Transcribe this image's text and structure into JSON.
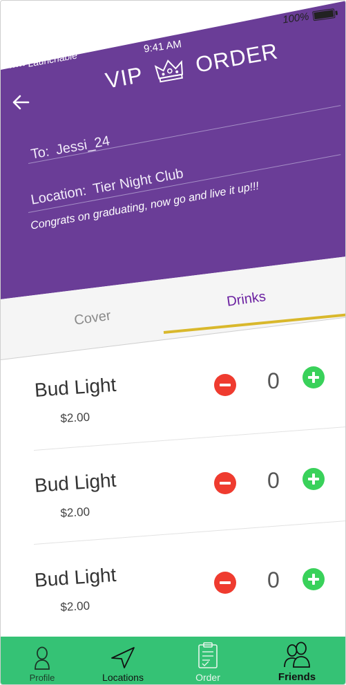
{
  "status_bar": {
    "carrier": "••••• Launchable",
    "time": "9:41 AM",
    "battery": "100%"
  },
  "header": {
    "title_left": "VIP",
    "title_right": "ORDER",
    "crown_icon": "crown-icon",
    "back_icon": "back-arrow-icon"
  },
  "form": {
    "to_label": "To:",
    "to_value": "Jessi_24",
    "location_label": "Location:",
    "location_value": "Tier Night Club",
    "message": "Congrats on graduating, now go and live it up!!!"
  },
  "tabs": [
    {
      "label": "Cover",
      "active": false
    },
    {
      "label": "Drinks",
      "active": true
    }
  ],
  "items": [
    {
      "name": "Bud Light",
      "price": "$2.00",
      "quantity": "0"
    },
    {
      "name": "Bud Light",
      "price": "$2.00",
      "quantity": "0"
    },
    {
      "name": "Bud Light",
      "price": "$2.00",
      "quantity": "0"
    }
  ],
  "nav": [
    {
      "label": "Profile",
      "icon": "person-icon"
    },
    {
      "label": "Locations",
      "icon": "navigation-arrow-icon"
    },
    {
      "label": "Order",
      "icon": "clipboard-icon",
      "active": true
    },
    {
      "label": "Friends",
      "icon": "friends-icon"
    }
  ],
  "colors": {
    "header_purple": "#6a3d97",
    "accent_underline": "#d9b82c",
    "active_tab_text": "#6a1fa0",
    "minus_red": "#ef3b2f",
    "plus_green": "#39d15a",
    "nav_green": "#35c275"
  }
}
